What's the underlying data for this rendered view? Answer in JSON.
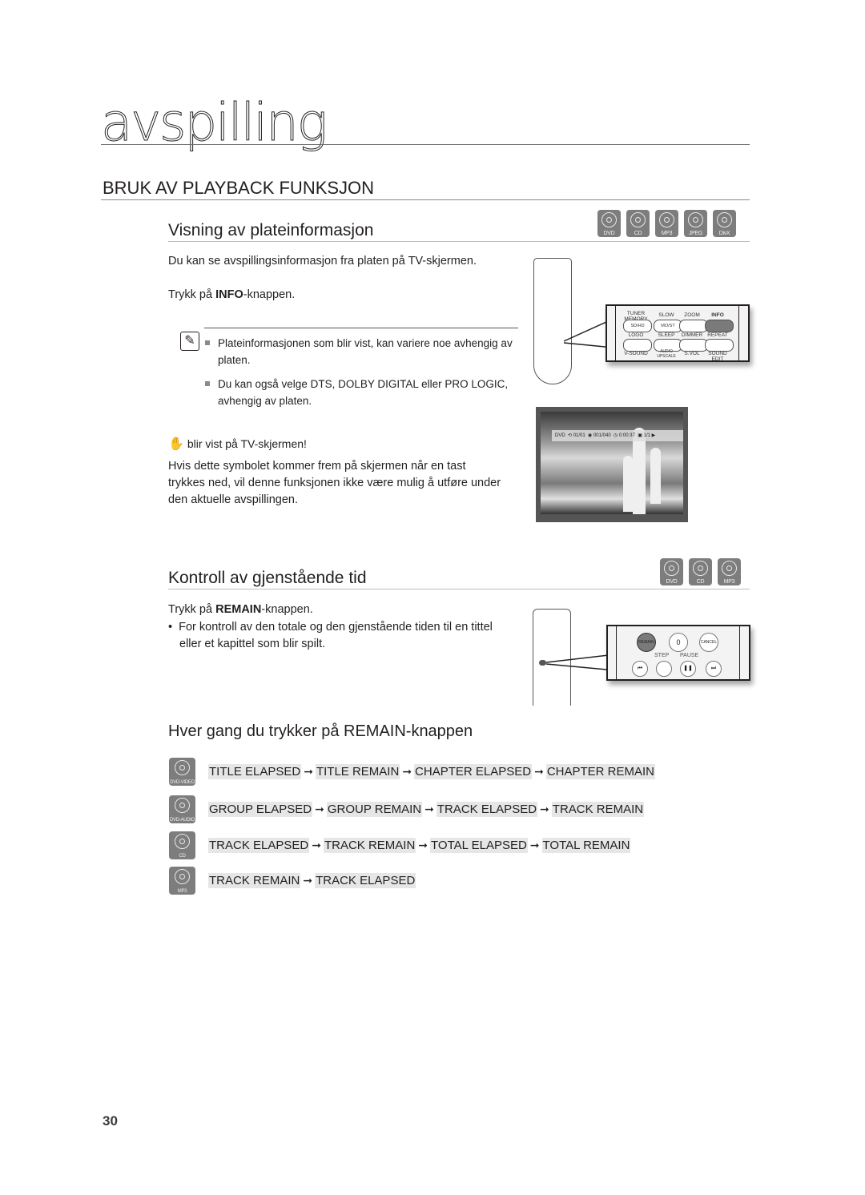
{
  "chapter": {
    "title": "avspilling"
  },
  "section": {
    "title": "BRUK AV PLAYBACK FUNKSJON"
  },
  "disc_info": {
    "title": "Visning av plateinformasjon",
    "discs": [
      "DVD",
      "CD",
      "MP3",
      "JPEG",
      "DivX"
    ],
    "intro": "Du kan se avspillingsinformasjon fra platen på TV-skjermen.",
    "press_prefix": "Trykk på ",
    "press_key": "INFO",
    "press_suffix": "-knappen.",
    "notes": [
      "Plateinformasjonen som blir vist, kan variere noe avhengig av platen.",
      "Du kan også velge DTS, DOLBY DIGITAL eller PRO LOGIC, avhengig av platen."
    ],
    "warning_title": "blir vist på TV-skjermen!",
    "warning_text": "Hvis dette symbolet kommer frem på skjermen når en tast trykkes ned, vil denne funksjonen ikke være mulig å utføre under den aktuelle avspillingen.",
    "remote_zoom": {
      "row1_labels": [
        "TUNER MEMORY",
        "SLOW",
        "ZOOM",
        "INFO"
      ],
      "row1_buttons": [
        "SD/HD",
        "MO/ST",
        "",
        ""
      ],
      "row2_labels": [
        "LOGO",
        "SLEEP",
        "DIMMER",
        "REPEAT"
      ],
      "row3_labels": [
        "V-SOUND",
        "AUDIO UPSCALE",
        "S.VOL",
        "SOUND EDIT"
      ],
      "highlighted": "INFO"
    },
    "osd": {
      "disc": "DVD",
      "title": "01/01",
      "chapter": "001/040",
      "time": "0:00:37",
      "angle": "1/1"
    }
  },
  "remain": {
    "title": "Kontroll av gjenstående tid",
    "discs": [
      "DVD",
      "CD",
      "MP3"
    ],
    "press_prefix": "Trykk på ",
    "press_key": "REMAIN",
    "press_suffix": "-knappen.",
    "bullet": "For kontroll av den totale og den gjenstående tiden til en tittel eller et kapittel som blir spilt.",
    "remote_zoom": {
      "buttons": [
        "REMAIN",
        "0",
        "CANCEL"
      ],
      "labels": [
        "STEP",
        "PAUSE"
      ],
      "highlighted": "REMAIN"
    }
  },
  "sequence": {
    "title": "Hver gang du trykker på REMAIN-knappen",
    "arrow": "➞",
    "rows": [
      {
        "disc": "DVD-VIDEO",
        "items": [
          "TITLE ELAPSED",
          "TITLE REMAIN",
          "CHAPTER ELAPSED",
          "CHAPTER REMAIN"
        ]
      },
      {
        "disc": "DVD-AUDIO",
        "items": [
          "GROUP ELAPSED",
          "GROUP REMAIN",
          "TRACK ELAPSED",
          "TRACK REMAIN"
        ]
      },
      {
        "disc": "CD",
        "items": [
          "TRACK ELAPSED",
          "TRACK REMAIN",
          "TOTAL ELAPSED",
          "TOTAL REMAIN"
        ]
      },
      {
        "disc": "MP3",
        "items": [
          "TRACK REMAIN",
          "TRACK ELAPSED"
        ]
      }
    ]
  },
  "page": {
    "number": "30"
  }
}
